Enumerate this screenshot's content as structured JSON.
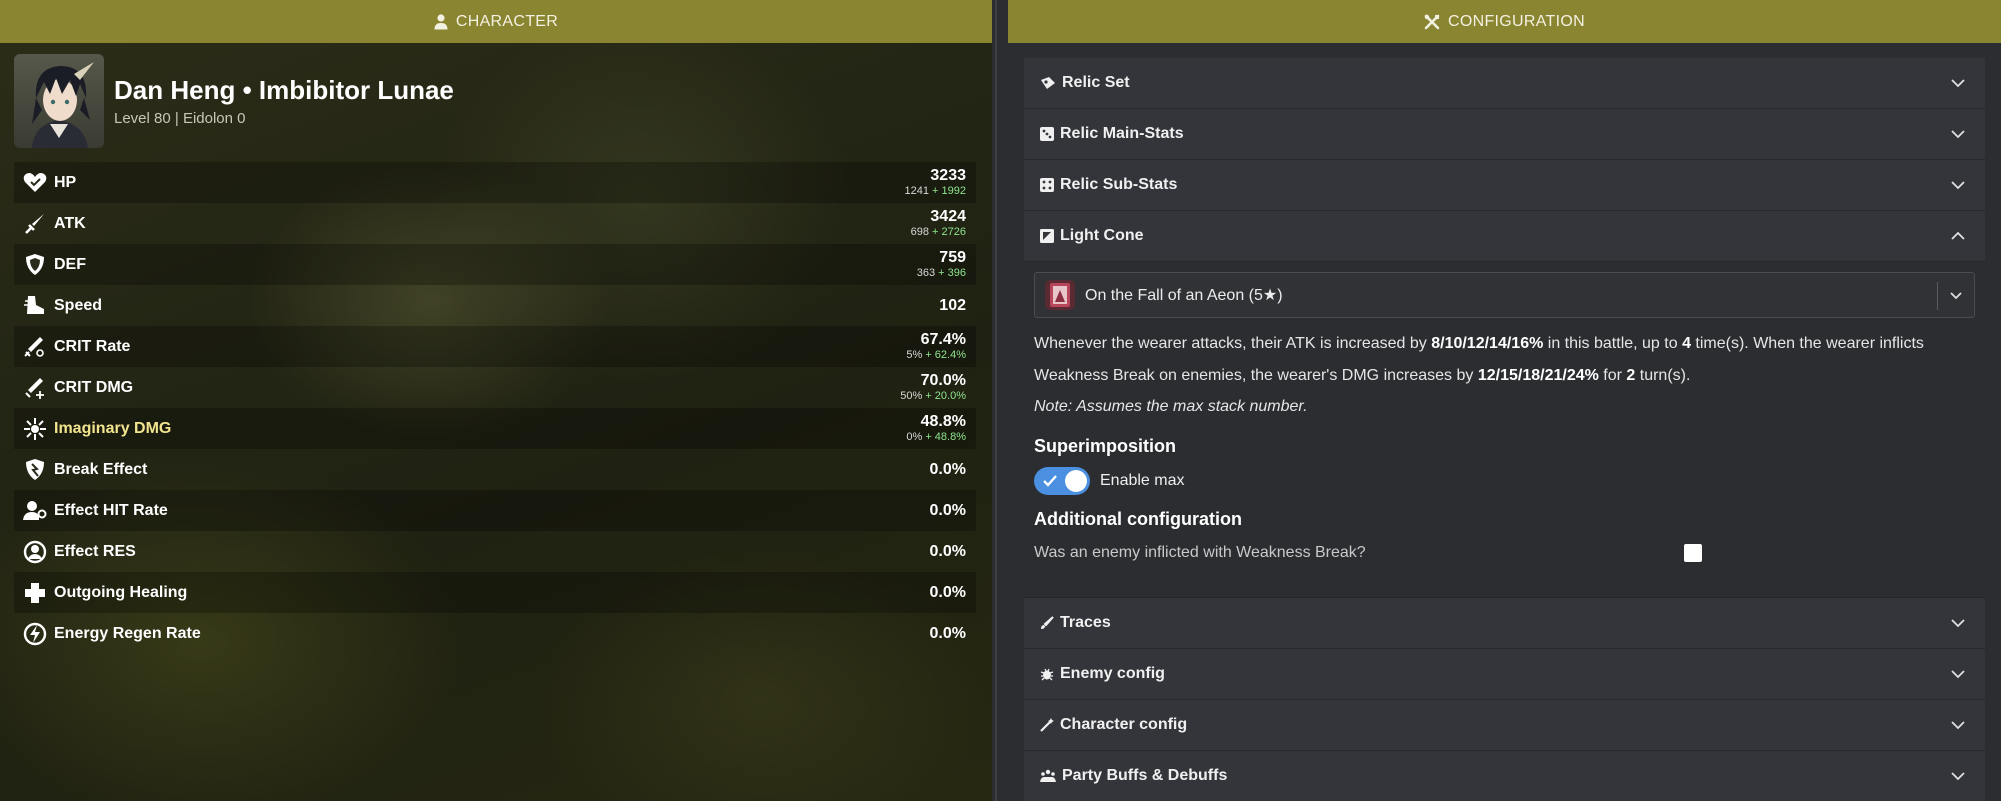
{
  "left_panel": {
    "header": "CHARACTER",
    "character": {
      "name": "Dan Heng • Imbibitor Lunae",
      "subtitle": "Level 80 | Eidolon 0"
    },
    "stats": [
      {
        "label": "HP",
        "icon": "heart-icon",
        "value": "3233",
        "base": "1241",
        "bonus": "+ 1992"
      },
      {
        "label": "ATK",
        "icon": "sword-icon",
        "value": "3424",
        "base": "698",
        "bonus": "+ 2726"
      },
      {
        "label": "DEF",
        "icon": "shield-icon",
        "value": "759",
        "base": "363",
        "bonus": "+ 396"
      },
      {
        "label": "Speed",
        "icon": "boot-icon",
        "value": "102",
        "base": "",
        "bonus": ""
      },
      {
        "label": "CRIT Rate",
        "icon": "crit-rate-icon",
        "value": "67.4%",
        "base": "5%",
        "bonus": "+ 62.4%"
      },
      {
        "label": "CRIT DMG",
        "icon": "crit-dmg-icon",
        "value": "70.0%",
        "base": "50%",
        "bonus": "+ 20.0%"
      },
      {
        "label": "Imaginary DMG",
        "icon": "imaginary-icon",
        "value": "48.8%",
        "base": "0%",
        "bonus": "+ 48.8%"
      },
      {
        "label": "Break Effect",
        "icon": "break-icon",
        "value": "0.0%",
        "base": "",
        "bonus": ""
      },
      {
        "label": "Effect HIT Rate",
        "icon": "effect-hit-icon",
        "value": "0.0%",
        "base": "",
        "bonus": ""
      },
      {
        "label": "Effect RES",
        "icon": "effect-res-icon",
        "value": "0.0%",
        "base": "",
        "bonus": ""
      },
      {
        "label": "Outgoing Healing",
        "icon": "healing-cross-icon",
        "value": "0.0%",
        "base": "",
        "bonus": ""
      },
      {
        "label": "Energy Regen Rate",
        "icon": "energy-icon",
        "value": "0.0%",
        "base": "",
        "bonus": ""
      }
    ]
  },
  "right_panel": {
    "header": "CONFIGURATION",
    "sections": {
      "relic_set": "Relic Set",
      "relic_main": "Relic Main-Stats",
      "relic_sub": "Relic Sub-Stats",
      "light_cone": "Light Cone",
      "traces": "Traces",
      "enemy": "Enemy config",
      "character": "Character config",
      "party": "Party Buffs & Debuffs"
    },
    "light_cone": {
      "selected": "On the Fall of an Aeon (5★)",
      "desc": {
        "p1": "Whenever the wearer attacks, their ATK is increased by ",
        "v1": "8/10/12/14/16%",
        "p2": " in this battle, up to ",
        "v2": "4",
        "p3": " time(s). When the wearer inflicts Weakness Break on enemies, the wearer's DMG increases by ",
        "v3": "12/15/18/21/24%",
        "p4": " for ",
        "v4": "2",
        "p5": " turn(s)."
      },
      "note": "Note: Assumes the max stack number.",
      "superimposition_label": "Superimposition",
      "toggle_label": "Enable max",
      "additional_label": "Additional configuration",
      "checkbox_label": "Was an enemy inflicted with Weakness Break?"
    }
  },
  "colors": {
    "header_bg": "#8a8530",
    "panel_bg": "#2b2d31",
    "accordion_bg": "#33353a",
    "toggle_on": "#4a8fe0",
    "stat_bonus": "#8ee58e",
    "imaginary_label": "#f2e58e"
  }
}
